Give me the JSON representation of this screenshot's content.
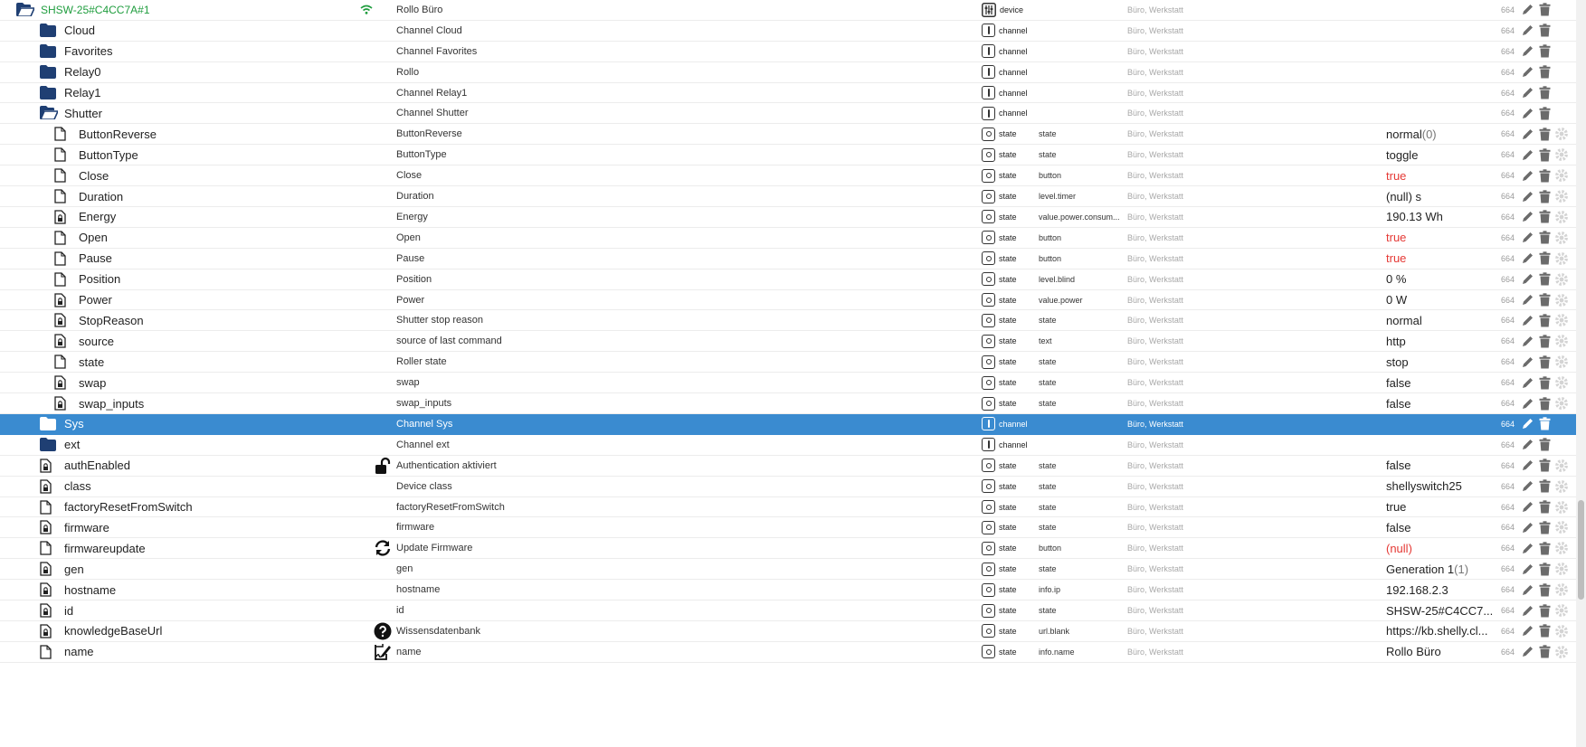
{
  "colors": {
    "folder": "#1f3f73",
    "selected": "#3a8bd0",
    "device_green": "#1f9d3e",
    "red_value": "#e53935"
  },
  "rows": [
    {
      "name": "SHSW-25#C4CC7A#1",
      "kind": "device",
      "icon": "folder-open-icon",
      "indent": 0,
      "extra": "wifi-icon",
      "label": "Rollo Büro",
      "type": "device",
      "type_icon": "device-icon",
      "role": "",
      "room": "Büro, Werkstatt",
      "value": "",
      "acl": "664",
      "actions": [
        "edit",
        "delete"
      ]
    },
    {
      "name": "Cloud",
      "kind": "folder",
      "icon": "folder-icon",
      "indent": 1,
      "label": "Channel Cloud",
      "type": "channel",
      "type_icon": "channel-icon",
      "role": "",
      "room": "Büro, Werkstatt",
      "value": "",
      "acl": "664",
      "actions": [
        "edit",
        "delete"
      ]
    },
    {
      "name": "Favorites",
      "kind": "folder",
      "icon": "folder-icon",
      "indent": 1,
      "label": "Channel Favorites",
      "type": "channel",
      "type_icon": "channel-icon",
      "role": "",
      "room": "Büro, Werkstatt",
      "value": "",
      "acl": "664",
      "actions": [
        "edit",
        "delete"
      ]
    },
    {
      "name": "Relay0",
      "kind": "folder",
      "icon": "folder-icon",
      "indent": 1,
      "label": "Rollo",
      "type": "channel",
      "type_icon": "channel-icon",
      "role": "",
      "room": "Büro, Werkstatt",
      "value": "",
      "acl": "664",
      "actions": [
        "edit",
        "delete"
      ]
    },
    {
      "name": "Relay1",
      "kind": "folder",
      "icon": "folder-icon",
      "indent": 1,
      "label": "Channel Relay1",
      "type": "channel",
      "type_icon": "channel-icon",
      "role": "",
      "room": "Büro, Werkstatt",
      "value": "",
      "acl": "664",
      "actions": [
        "edit",
        "delete"
      ]
    },
    {
      "name": "Shutter",
      "kind": "folder",
      "icon": "folder-open-icon",
      "indent": 1,
      "label": "Channel Shutter",
      "type": "channel",
      "type_icon": "channel-icon",
      "role": "",
      "room": "Büro, Werkstatt",
      "value": "",
      "acl": "664",
      "actions": [
        "edit",
        "delete"
      ]
    },
    {
      "name": "ButtonReverse",
      "kind": "file",
      "icon": "file-icon",
      "indent": 2,
      "label": "ButtonReverse",
      "type": "state",
      "type_icon": "state-icon",
      "role": "state",
      "room": "Büro, Werkstatt",
      "value": "normal",
      "value_sub": "(0)",
      "acl": "664",
      "actions": [
        "edit",
        "delete",
        "settings"
      ]
    },
    {
      "name": "ButtonType",
      "kind": "file",
      "icon": "file-icon",
      "indent": 2,
      "label": "ButtonType",
      "type": "state",
      "type_icon": "state-icon",
      "role": "state",
      "room": "Büro, Werkstatt",
      "value": "toggle",
      "acl": "664",
      "actions": [
        "edit",
        "delete",
        "settings"
      ]
    },
    {
      "name": "Close",
      "kind": "file",
      "icon": "file-icon",
      "indent": 2,
      "label": "Close",
      "type": "state",
      "type_icon": "state-icon",
      "role": "button",
      "room": "Büro, Werkstatt",
      "value": "true",
      "value_color": "red",
      "acl": "664",
      "actions": [
        "edit",
        "delete",
        "settings"
      ]
    },
    {
      "name": "Duration",
      "kind": "file",
      "icon": "file-icon",
      "indent": 2,
      "label": "Duration",
      "type": "state",
      "type_icon": "state-icon",
      "role": "level.timer",
      "room": "Büro, Werkstatt",
      "value": "(null) s",
      "acl": "664",
      "actions": [
        "edit",
        "delete",
        "settings"
      ]
    },
    {
      "name": "Energy",
      "kind": "file-lock",
      "icon": "file-lock-icon",
      "indent": 2,
      "label": "Energy",
      "type": "state",
      "type_icon": "state-icon",
      "role": "value.power.consum...",
      "room": "Büro, Werkstatt",
      "value": "190.13 Wh",
      "acl": "664",
      "actions": [
        "edit",
        "delete",
        "settings"
      ]
    },
    {
      "name": "Open",
      "kind": "file",
      "icon": "file-icon",
      "indent": 2,
      "label": "Open",
      "type": "state",
      "type_icon": "state-icon",
      "role": "button",
      "room": "Büro, Werkstatt",
      "value": "true",
      "value_color": "red",
      "acl": "664",
      "actions": [
        "edit",
        "delete",
        "settings"
      ]
    },
    {
      "name": "Pause",
      "kind": "file",
      "icon": "file-icon",
      "indent": 2,
      "label": "Pause",
      "type": "state",
      "type_icon": "state-icon",
      "role": "button",
      "room": "Büro, Werkstatt",
      "value": "true",
      "value_color": "red",
      "acl": "664",
      "actions": [
        "edit",
        "delete",
        "settings"
      ]
    },
    {
      "name": "Position",
      "kind": "file",
      "icon": "file-icon",
      "indent": 2,
      "label": "Position",
      "type": "state",
      "type_icon": "state-icon",
      "role": "level.blind",
      "room": "Büro, Werkstatt",
      "value": "0 %",
      "acl": "664",
      "actions": [
        "edit",
        "delete",
        "settings"
      ]
    },
    {
      "name": "Power",
      "kind": "file-lock",
      "icon": "file-lock-icon",
      "indent": 2,
      "label": "Power",
      "type": "state",
      "type_icon": "state-icon",
      "role": "value.power",
      "room": "Büro, Werkstatt",
      "value": "0 W",
      "acl": "664",
      "actions": [
        "edit",
        "delete",
        "settings"
      ]
    },
    {
      "name": "StopReason",
      "kind": "file-lock",
      "icon": "file-lock-icon",
      "indent": 2,
      "label": "Shutter stop reason",
      "type": "state",
      "type_icon": "state-icon",
      "role": "state",
      "room": "Büro, Werkstatt",
      "value": "normal",
      "acl": "664",
      "actions": [
        "edit",
        "delete",
        "settings"
      ]
    },
    {
      "name": "source",
      "kind": "file-lock",
      "icon": "file-lock-icon",
      "indent": 2,
      "label": "source of last command",
      "type": "state",
      "type_icon": "state-icon",
      "role": "text",
      "room": "Büro, Werkstatt",
      "value": "http",
      "acl": "664",
      "actions": [
        "edit",
        "delete",
        "settings"
      ]
    },
    {
      "name": "state",
      "kind": "file",
      "icon": "file-icon",
      "indent": 2,
      "label": "Roller state",
      "type": "state",
      "type_icon": "state-icon",
      "role": "state",
      "room": "Büro, Werkstatt",
      "value": "stop",
      "acl": "664",
      "actions": [
        "edit",
        "delete",
        "settings"
      ]
    },
    {
      "name": "swap",
      "kind": "file-lock",
      "icon": "file-lock-icon",
      "indent": 2,
      "label": "swap",
      "type": "state",
      "type_icon": "state-icon",
      "role": "state",
      "room": "Büro, Werkstatt",
      "value": "false",
      "acl": "664",
      "actions": [
        "edit",
        "delete",
        "settings"
      ]
    },
    {
      "name": "swap_inputs",
      "kind": "file-lock",
      "icon": "file-lock-icon",
      "indent": 2,
      "label": "swap_inputs",
      "type": "state",
      "type_icon": "state-icon",
      "role": "state",
      "room": "Büro, Werkstatt",
      "value": "false",
      "acl": "664",
      "actions": [
        "edit",
        "delete",
        "settings"
      ]
    },
    {
      "name": "Sys",
      "kind": "folder",
      "icon": "folder-icon",
      "indent": 1,
      "label": "Channel Sys",
      "type": "channel",
      "type_icon": "channel-icon",
      "role": "",
      "room": "Büro, Werkstatt",
      "value": "",
      "acl": "664",
      "selected": true,
      "actions": [
        "edit",
        "delete"
      ]
    },
    {
      "name": "ext",
      "kind": "folder",
      "icon": "folder-icon",
      "indent": 1,
      "label": "Channel ext",
      "type": "channel",
      "type_icon": "channel-icon",
      "role": "",
      "room": "Büro, Werkstatt",
      "value": "",
      "acl": "664",
      "actions": [
        "edit",
        "delete"
      ]
    },
    {
      "name": "authEnabled",
      "kind": "file-lock",
      "icon": "file-lock-icon",
      "indent": 1,
      "extra": "unlock-icon",
      "label": "Authentication aktiviert",
      "type": "state",
      "type_icon": "state-icon",
      "role": "state",
      "room": "Büro, Werkstatt",
      "value": "false",
      "acl": "664",
      "actions": [
        "edit",
        "delete",
        "settings"
      ]
    },
    {
      "name": "class",
      "kind": "file-lock",
      "icon": "file-lock-icon",
      "indent": 1,
      "label": "Device class",
      "type": "state",
      "type_icon": "state-icon",
      "role": "state",
      "room": "Büro, Werkstatt",
      "value": "shellyswitch25",
      "acl": "664",
      "actions": [
        "edit",
        "delete",
        "settings"
      ]
    },
    {
      "name": "factoryResetFromSwitch",
      "kind": "file",
      "icon": "file-icon",
      "indent": 1,
      "label": "factoryResetFromSwitch",
      "type": "state",
      "type_icon": "state-icon",
      "role": "state",
      "room": "Büro, Werkstatt",
      "value": "true",
      "acl": "664",
      "actions": [
        "edit",
        "delete",
        "settings"
      ]
    },
    {
      "name": "firmware",
      "kind": "file-lock",
      "icon": "file-lock-icon",
      "indent": 1,
      "label": "firmware",
      "type": "state",
      "type_icon": "state-icon",
      "role": "state",
      "room": "Büro, Werkstatt",
      "value": "false",
      "acl": "664",
      "actions": [
        "edit",
        "delete",
        "settings"
      ]
    },
    {
      "name": "firmwareupdate",
      "kind": "file",
      "icon": "file-icon",
      "indent": 1,
      "extra": "sync-icon",
      "label": "Update Firmware",
      "type": "state",
      "type_icon": "state-icon",
      "role": "button",
      "room": "Büro, Werkstatt",
      "value": "(null)",
      "value_color": "red",
      "acl": "664",
      "actions": [
        "edit",
        "delete",
        "settings"
      ]
    },
    {
      "name": "gen",
      "kind": "file-lock",
      "icon": "file-lock-icon",
      "indent": 1,
      "label": "gen",
      "type": "state",
      "type_icon": "state-icon",
      "role": "state",
      "room": "Büro, Werkstatt",
      "value": "Generation 1",
      "value_sub": "(1)",
      "acl": "664",
      "actions": [
        "edit",
        "delete",
        "settings"
      ]
    },
    {
      "name": "hostname",
      "kind": "file-lock",
      "icon": "file-lock-icon",
      "indent": 1,
      "label": "hostname",
      "type": "state",
      "type_icon": "state-icon",
      "role": "info.ip",
      "room": "Büro, Werkstatt",
      "value": "192.168.2.3",
      "acl": "664",
      "actions": [
        "edit",
        "delete",
        "settings"
      ]
    },
    {
      "name": "id",
      "kind": "file-lock",
      "icon": "file-lock-icon",
      "indent": 1,
      "label": "id",
      "type": "state",
      "type_icon": "state-icon",
      "role": "state",
      "room": "Büro, Werkstatt",
      "value": "SHSW-25#C4CC7...",
      "acl": "664",
      "actions": [
        "edit",
        "delete",
        "settings"
      ]
    },
    {
      "name": "knowledgeBaseUrl",
      "kind": "file-lock",
      "icon": "file-lock-icon",
      "indent": 1,
      "extra": "question-icon",
      "label": "Wissensdatenbank",
      "type": "state",
      "type_icon": "state-icon",
      "role": "url.blank",
      "room": "Büro, Werkstatt",
      "value": "https://kb.shelly.cl...",
      "acl": "664",
      "actions": [
        "edit",
        "delete",
        "settings"
      ]
    },
    {
      "name": "name",
      "kind": "file",
      "icon": "file-icon",
      "indent": 1,
      "extra": "signature-icon",
      "label": "name",
      "type": "state",
      "type_icon": "state-icon",
      "role": "info.name",
      "room": "Büro, Werkstatt",
      "value": "Rollo Büro",
      "acl": "664",
      "actions": [
        "edit",
        "delete",
        "settings"
      ]
    }
  ]
}
